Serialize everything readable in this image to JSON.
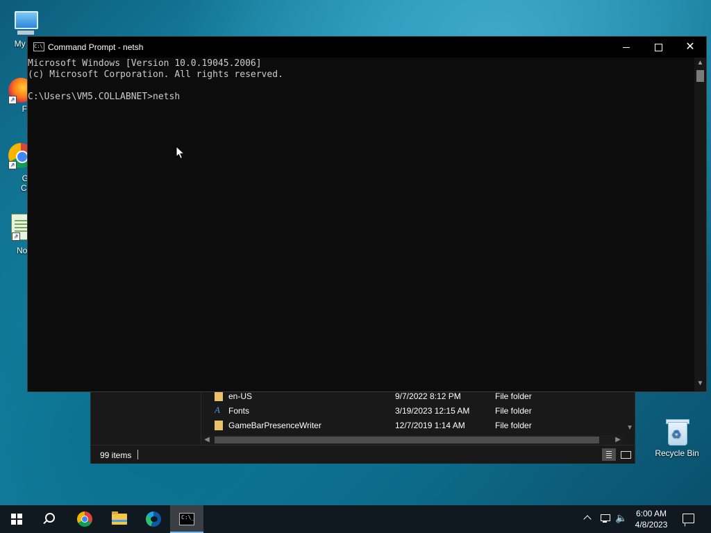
{
  "desktop": {
    "icons": [
      {
        "label": "My Co"
      },
      {
        "label": "Fire"
      },
      {
        "label": "Goo"
      },
      {
        "label": "Chro"
      },
      {
        "label": "Notep"
      }
    ],
    "recycle_bin_label": "Recycle Bin"
  },
  "explorer": {
    "rows": [
      {
        "name": "en-US",
        "date": "9/7/2022 8:12 PM",
        "type": "File folder",
        "icon": "folder-icon"
      },
      {
        "name": "Fonts",
        "date": "3/19/2023 12:15 AM",
        "type": "File folder",
        "icon": "font-folder-icon"
      },
      {
        "name": "GameBarPresenceWriter",
        "date": "12/7/2019 1:14 AM",
        "type": "File folder",
        "icon": "folder-icon"
      }
    ],
    "status_count": "99 items"
  },
  "cmd": {
    "title": "Command Prompt - netsh",
    "icon_text": "C:\\",
    "lines": [
      "Microsoft Windows [Version 10.0.19045.2006]",
      "(c) Microsoft Corporation. All rights reserved.",
      "",
      "C:\\Users\\VM5.COLLABNET>netsh"
    ]
  },
  "taskbar": {
    "time": "6:00 AM",
    "date": "4/8/2023",
    "cmd_icon_text": "C:\\_"
  },
  "colors": {
    "console_text": "#cccccc",
    "console_bg": "#0c0c0c",
    "taskbar_bg": "#101820",
    "active_indicator": "#76b9ed"
  }
}
